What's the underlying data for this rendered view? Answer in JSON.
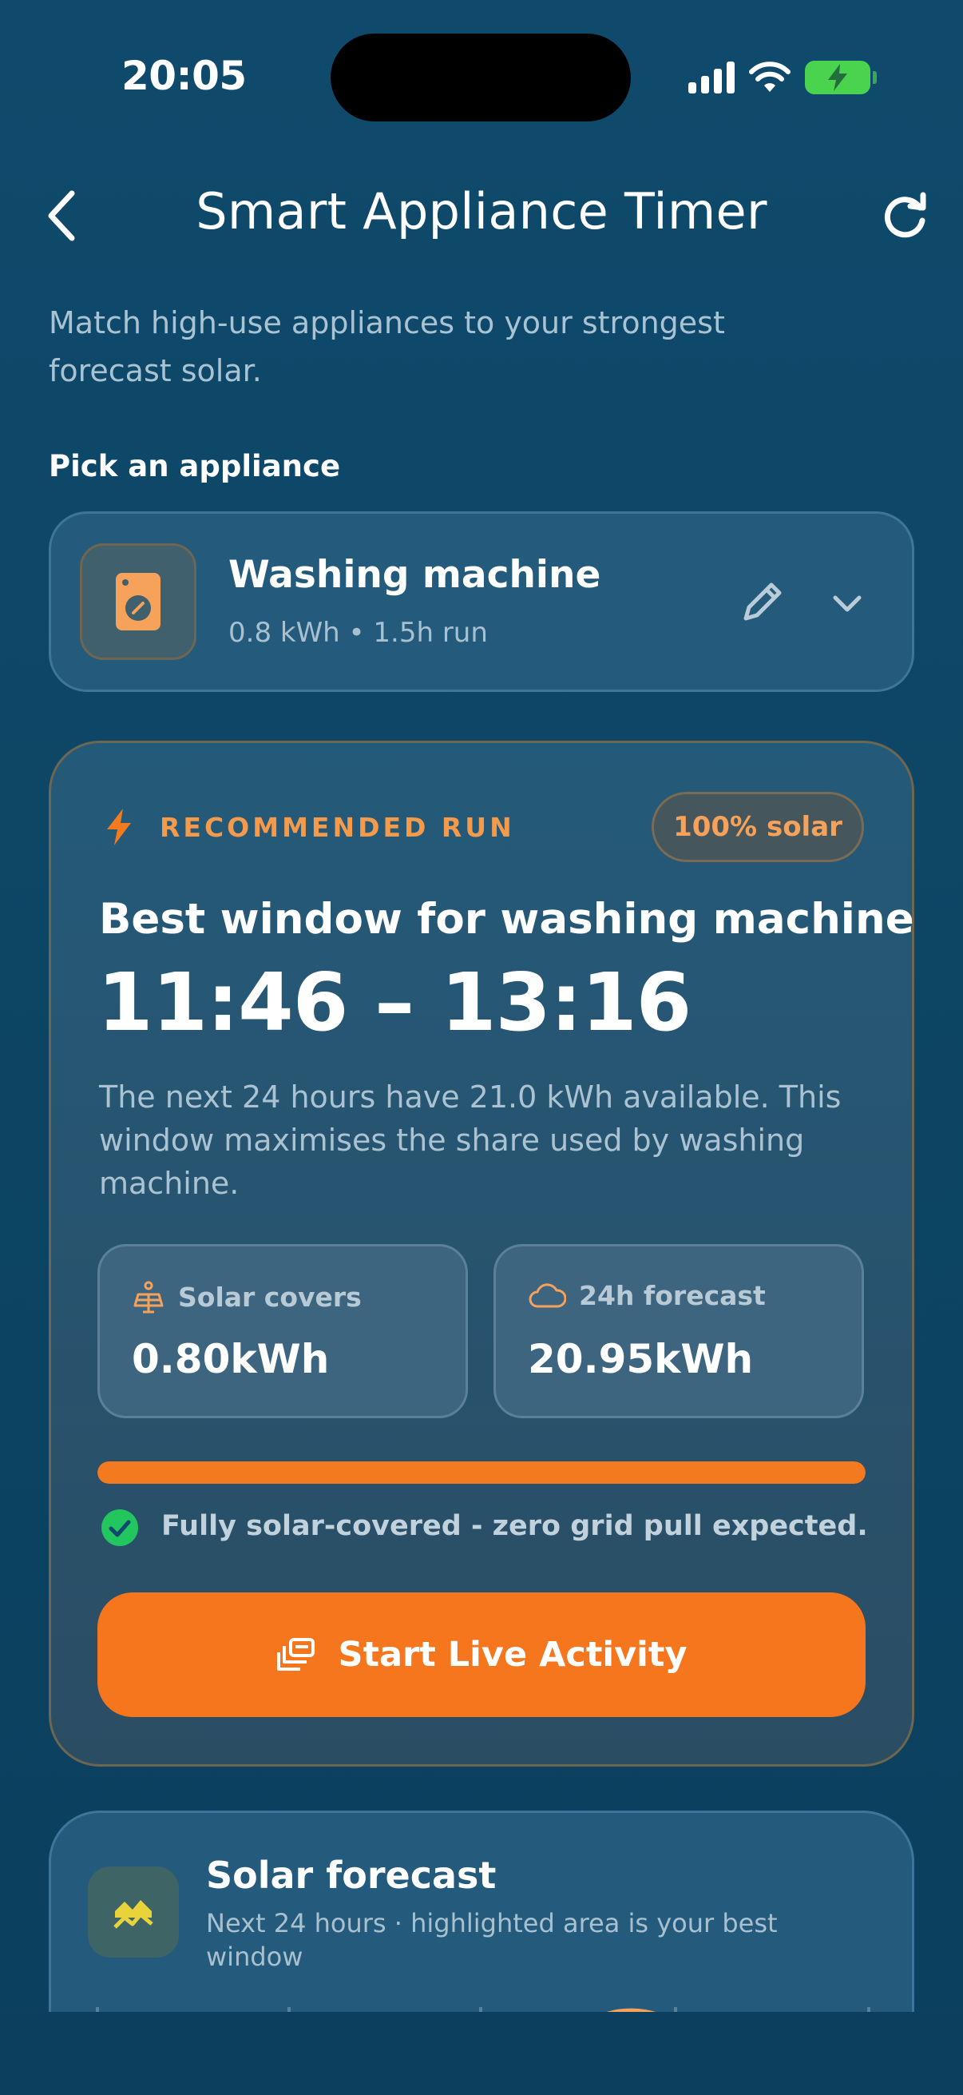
{
  "status_bar": {
    "time": "20:05"
  },
  "header": {
    "title": "Smart Appliance Timer"
  },
  "subtitle": "Match high-use appliances to your strongest forecast solar.",
  "picker": {
    "section_label": "Pick an appliance",
    "appliance_name": "Washing machine",
    "appliance_meta": "0.8 kWh • 1.5h run"
  },
  "recommendation": {
    "label": "RECOMMENDED RUN",
    "badge": "100% solar",
    "title": "Best window for washing machine",
    "window": "11:46 – 13:16",
    "description": "The next 24 hours have 21.0 kWh available. This window maximises the share used by washing machine.",
    "stats": [
      {
        "icon": "solar-panel-icon",
        "label": "Solar covers",
        "value": "0.80kWh"
      },
      {
        "icon": "cloud-icon",
        "label": "24h forecast",
        "value": "20.95kWh"
      }
    ],
    "solar_coverage_fraction": 1.0,
    "note": "Fully solar-covered - zero grid pull expected.",
    "cta_label": "Start Live Activity"
  },
  "forecast": {
    "title": "Solar forecast",
    "subtitle": "Next 24 hours · highlighted area is your best window"
  },
  "colors": {
    "background": "#0f4a6c",
    "accent_orange": "#f5761d",
    "label_orange": "#f49a4c",
    "success_green": "#22c55e",
    "battery_green": "#4ad34f"
  }
}
